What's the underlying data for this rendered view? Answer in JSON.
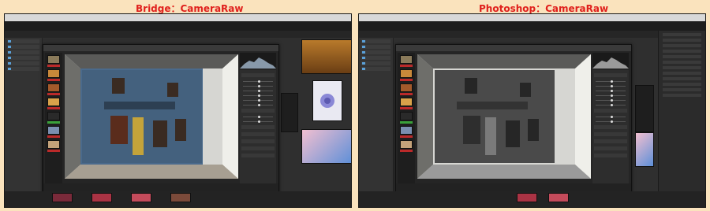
{
  "captions": {
    "left": "Bridge：CameraRaw",
    "right": "Photoshop：CameraRaw"
  },
  "left_screenshot": {
    "app": "Bridge",
    "camera_raw_dialog": {
      "primary_button_color": "#3aa13a"
    }
  },
  "right_screenshot": {
    "app": "Photoshop",
    "camera_raw_dialog": {
      "primary_button_color": "#3aa13a"
    }
  },
  "colors": {
    "background": "#fae3bd",
    "caption": "#e0201c",
    "ui_dark": "#2f2f2f",
    "accent_green": "#3aa13a"
  },
  "icons": [
    "folder-icon",
    "slider-handle-icon"
  ]
}
